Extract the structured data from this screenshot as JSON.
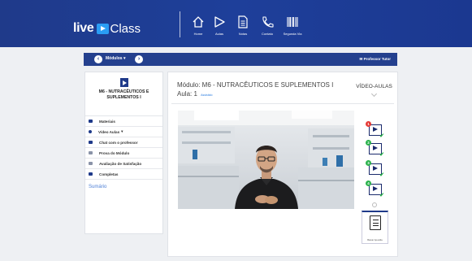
{
  "header": {
    "logo_live": "live",
    "logo_class": "Class",
    "nav": [
      {
        "label": "Home",
        "icon": "home-icon"
      },
      {
        "label": "Aulas",
        "icon": "play-icon"
      },
      {
        "label": "Notas",
        "icon": "document-icon"
      },
      {
        "label": "Contato",
        "icon": "phone-icon"
      },
      {
        "label": "Segunda Via",
        "icon": "barcode-icon"
      }
    ]
  },
  "subbar": {
    "modules_label": "Módulos",
    "professor_label": "Professor Tutor"
  },
  "sidebar": {
    "module_title": "M6 - NUTRACÊUTICOS E SUPLEMENTOS I",
    "items": [
      {
        "label": "Materiais"
      },
      {
        "label": "Vídeo Aulas"
      },
      {
        "label": "Chat com o professor"
      },
      {
        "label": "Prova do Módulo"
      },
      {
        "label": "Avaliação de Satisfação"
      },
      {
        "label": "Completas"
      }
    ],
    "sumario_label": "Sumário"
  },
  "main": {
    "module_line": "Módulo: M6 - NUTRACÊUTICOS E SUPLEMENTOS I",
    "aula_label": "Aula: 1",
    "assistido": "Assistido",
    "videoaulas_label": "VÍDEO-AULAS",
    "lessons": [
      {
        "num": "1",
        "color": "#e53935"
      },
      {
        "num": "2",
        "color": "#2bb24c"
      },
      {
        "num": "3",
        "color": "#2bb24c"
      },
      {
        "num": "4",
        "color": "#2bb24c"
      }
    ],
    "doc_label": "Baixar Apostila"
  },
  "colors": {
    "header_blue": "#1f3a8a",
    "subbar_blue": "#24408e",
    "check_green": "#2bb24c",
    "link_blue": "#4d7fd6"
  }
}
